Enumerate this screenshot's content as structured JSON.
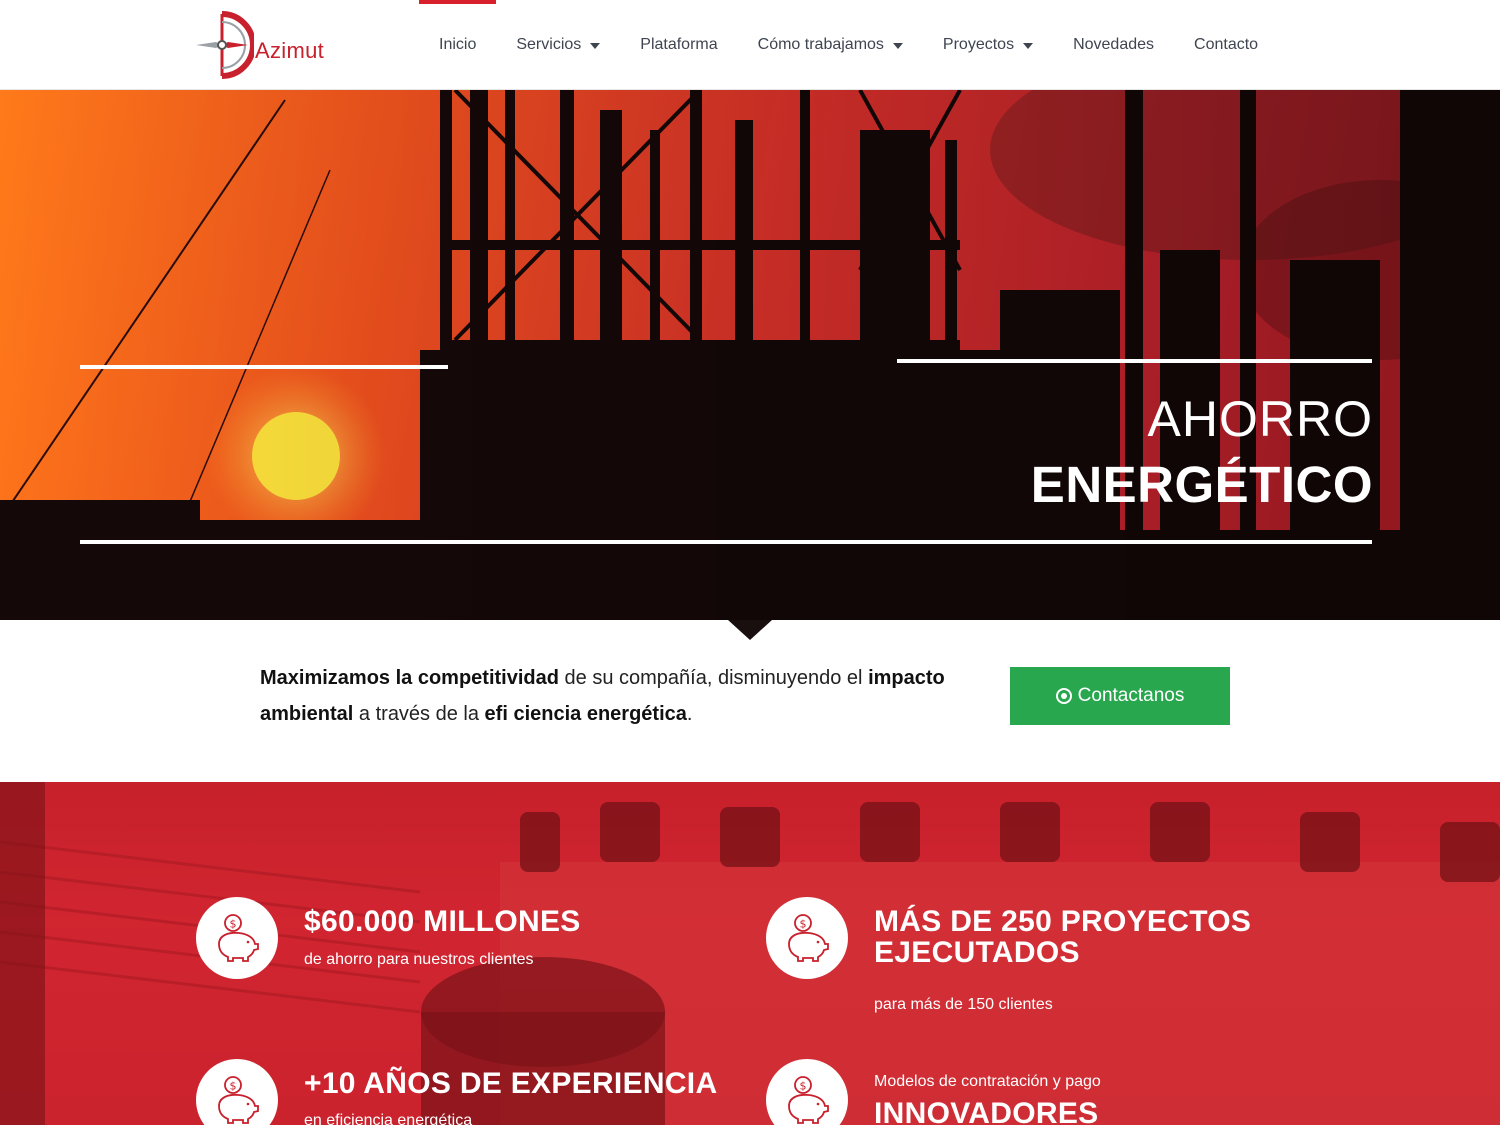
{
  "brand": {
    "name": "Azimut",
    "accent": "#d8202c"
  },
  "nav": {
    "items": [
      {
        "label": "Inicio"
      },
      {
        "label": "Servicios"
      },
      {
        "label": "Plataforma"
      },
      {
        "label": "Cómo trabajamos"
      },
      {
        "label": "Proyectos"
      },
      {
        "label": "Novedades"
      },
      {
        "label": "Contacto"
      }
    ]
  },
  "hero": {
    "title_line1": "AHORRO",
    "title_line2": "ENERGÉTICO"
  },
  "intro": {
    "bold1": "Maximizamos la competitividad",
    "text1": " de su compañía, disminuyendo el ",
    "bold2": "impacto ambiental",
    "text2": " a través de la ",
    "bold3": "efi  ciencia energética",
    "text3": "."
  },
  "cta": {
    "label": "Contactanos",
    "icon": "whatsapp-icon",
    "color": "#29a74f"
  },
  "stats": [
    {
      "icon": "piggy-bank-icon",
      "title": "$60.000 MILLONES",
      "subtitle": "de ahorro para nuestros clientes"
    },
    {
      "icon": "piggy-bank-icon",
      "title": "MÁS DE 250 PROYECTOS EJECUTADOS",
      "subtitle": "para más de 150 clientes"
    },
    {
      "icon": "piggy-bank-icon",
      "title": "+10 AÑOS DE EXPERIENCIA",
      "subtitle": "en eficiencia energética"
    },
    {
      "icon": "piggy-bank-icon",
      "pre": "Modelos de contratación y pago",
      "title": "INNOVADORES"
    }
  ]
}
